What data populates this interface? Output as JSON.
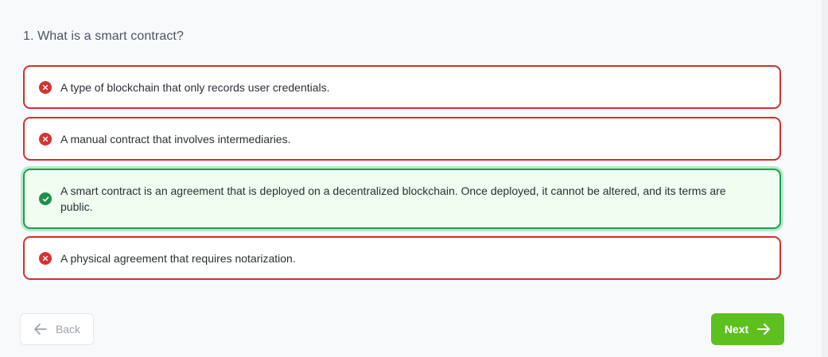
{
  "question": {
    "text": "1. What is a smart contract?"
  },
  "options": [
    {
      "text": "A type of blockchain that only records user credentials.",
      "status": "incorrect",
      "icon": "x-circle-icon"
    },
    {
      "text": "A manual contract that involves intermediaries.",
      "status": "incorrect",
      "icon": "x-circle-icon"
    },
    {
      "text": "A smart contract is an agreement that is deployed on a decentralized blockchain. Once deployed, it cannot be altered, and its terms are public.",
      "status": "correct",
      "icon": "check-circle-icon"
    },
    {
      "text": "A physical agreement that requires notarization.",
      "status": "incorrect",
      "icon": "x-circle-icon"
    }
  ],
  "navigation": {
    "back_label": "Back",
    "next_label": "Next",
    "back_icon": "arrow-left-icon",
    "next_icon": "arrow-right-icon"
  },
  "colors": {
    "incorrect": "#d0312d",
    "correct": "#1f9d55",
    "next_button": "#5ec01e"
  }
}
